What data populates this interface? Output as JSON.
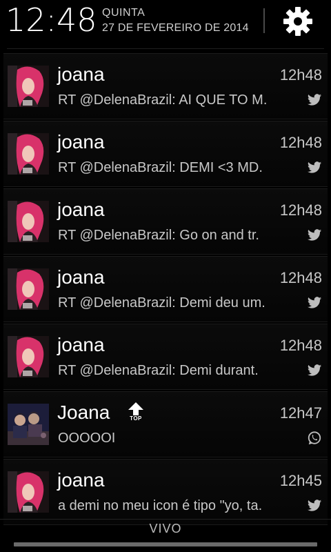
{
  "status": {
    "time": "12:48",
    "day": "QUINTA",
    "date": "27 DE FEVEREIRO DE 2014",
    "settings_icon": "gear-icon"
  },
  "notifications": [
    {
      "title": "joana",
      "time": "12h48",
      "text": "RT @DelenaBrazil: AI QUE TO M.",
      "app_icon": "twitter-icon",
      "avatar": "pink-hair-photo"
    },
    {
      "title": "joana",
      "time": "12h48",
      "text": "RT @DelenaBrazil: DEMI <3 MD.",
      "app_icon": "twitter-icon",
      "avatar": "pink-hair-photo"
    },
    {
      "title": "joana",
      "time": "12h48",
      "text": "RT @DelenaBrazil: Go on and tr.",
      "app_icon": "twitter-icon",
      "avatar": "pink-hair-photo"
    },
    {
      "title": "joana",
      "time": "12h48",
      "text": "RT @DelenaBrazil: Demi deu um.",
      "app_icon": "twitter-icon",
      "avatar": "pink-hair-photo"
    },
    {
      "title": "joana",
      "time": "12h48",
      "text": "RT @DelenaBrazil: Demi durant.",
      "app_icon": "twitter-icon",
      "avatar": "pink-hair-photo"
    },
    {
      "title": "Joana",
      "time": "12h47",
      "text": "OOOOOI",
      "app_icon": "whatsapp-icon",
      "avatar": "group-photo",
      "badge": "TOP"
    },
    {
      "title": "joana",
      "time": "12h45",
      "text": "a demi no meu icon é tipo \"yo, ta.",
      "app_icon": "twitter-icon",
      "avatar": "pink-hair-photo"
    }
  ],
  "carrier": "VIVO",
  "colors": {
    "background": "#000000",
    "text_primary": "#ffffff",
    "text_secondary": "#c8c8c8",
    "avatar_pink": "#e0356e"
  }
}
